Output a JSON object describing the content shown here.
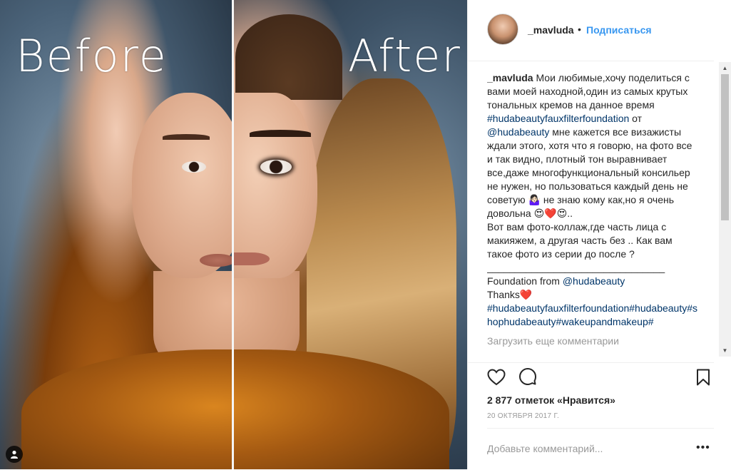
{
  "photo": {
    "before_label": "Before",
    "after_label": "After",
    "user_tag_icon": "user-icon"
  },
  "header": {
    "username": "_mavluda",
    "separator": "•",
    "follow_label": "Подписаться"
  },
  "caption": {
    "username": "_mavluda",
    "text_1": " Мои любимые,хочу поделиться с вами моей находной,один из самых крутых тональных кремов на данное время ",
    "hashtag_1": "#hudabeautyfauxfilterfoundation",
    "text_2": " от ",
    "mention_1": "@hudabeauty",
    "text_3": " мне кажется все визажисты ждали этого, хотя что я говорю, на фото все и так видно, плотный тон выравнивает все,даже многофункциональный консильер не нужен, но пользоваться каждый день не советую ",
    "emoji_1": "🤷🏻‍♀️",
    "text_4": " не знаю кому как,но я очень довольна ",
    "emoji_2": "😍❤️😍",
    "text_5": "..",
    "line_2": "Вот вам фото-коллаж,где часть лица с макияжем, а другая часть без .. Как вам такое фото из серии до после ?",
    "separator_line": "________________________________",
    "line_4_prefix": "Foundation from ",
    "mention_2": "@hudabeauty",
    "line_5": "Thanks",
    "emoji_3": "❤️",
    "hashtags_tail": "#hudabeautyfauxfilterfoundation#hudabeauty#shophudabeauty#wakeupandmakeup#",
    "load_more": "Загрузить еще комментарии"
  },
  "actions": {
    "like_icon": "heart-icon",
    "comment_icon": "comment-icon",
    "save_icon": "bookmark-icon"
  },
  "likes_text": "2 877 отметок «Нравится»",
  "date_text": "20 ОКТЯБРЯ 2017 Г.",
  "comment": {
    "placeholder": "Добавьте комментарий...",
    "more_label": "•••"
  },
  "colors": {
    "link_blue": "#3897f0",
    "hashtag_blue": "#003569",
    "muted_gray": "#999999"
  }
}
